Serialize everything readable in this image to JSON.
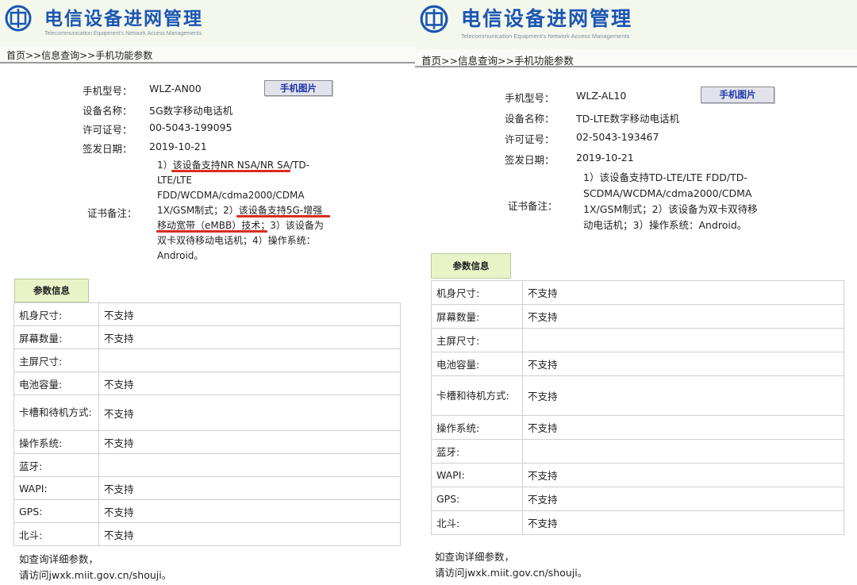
{
  "banner": {
    "title": "电信设备进网管理",
    "subtitle": "Telecommunication Equipment's Network Access Managements"
  },
  "breadcrumb": "首页>>信息查询>>手机功能参数",
  "labels": {
    "model": "手机型号：",
    "device_name": "设备名称：",
    "license": "许可证号：",
    "issue_date": "签发日期：",
    "remarks": "证书备注：",
    "photo_button": "手机图片",
    "params_header": "参数信息"
  },
  "left": {
    "model": "WLZ-AN00",
    "device_name": "5G数字移动电话机",
    "license": "00-5043-199095",
    "issue_date": "2019-10-21",
    "remarks_lines": [
      "1）该设备支持NR NSA/NR SA/TD-",
      "LTE/LTE",
      "FDD/WCDMA/cdma2000/CDMA",
      "1X/GSM制式；2）该设备支持5G-增强",
      "移动宽带（eMBB）技术；3）该设备为",
      "双卡双待移动电话机；4）操作系统：",
      "Android。"
    ],
    "params": [
      {
        "label": "机身尺寸:",
        "value": "不支持"
      },
      {
        "label": "屏幕数量:",
        "value": "不支持"
      },
      {
        "label": "主屏尺寸:",
        "value": ""
      },
      {
        "label": "电池容量:",
        "value": "不支持"
      },
      {
        "label": "卡槽和待机方式:",
        "value": "不支持"
      },
      {
        "label": "操作系统:",
        "value": "不支持"
      },
      {
        "label": "蓝牙:",
        "value": ""
      },
      {
        "label": "WAPI:",
        "value": "不支持"
      },
      {
        "label": "GPS:",
        "value": "不支持"
      },
      {
        "label": "北斗:",
        "value": "不支持"
      }
    ]
  },
  "right": {
    "model": "WLZ-AL10",
    "device_name": "TD-LTE数字移动电话机",
    "license": "02-5043-193467",
    "issue_date": "2019-10-21",
    "remarks_lines": [
      "1）该设备支持TD-LTE/LTE FDD/TD-",
      "SCDMA/WCDMA/cdma2000/CDMA",
      "1X/GSM制式；2）该设备为双卡双待移",
      "动电话机；3）操作系统：Android。"
    ],
    "params": [
      {
        "label": "机身尺寸:",
        "value": "不支持"
      },
      {
        "label": "屏幕数量:",
        "value": "不支持"
      },
      {
        "label": "主屏尺寸:",
        "value": ""
      },
      {
        "label": "电池容量:",
        "value": "不支持"
      },
      {
        "label": "卡槽和待机方式:",
        "value": "不支持"
      },
      {
        "label": "操作系统:",
        "value": "不支持"
      },
      {
        "label": "蓝牙:",
        "value": ""
      },
      {
        "label": "WAPI:",
        "value": "不支持"
      },
      {
        "label": "GPS:",
        "value": "不支持"
      },
      {
        "label": "北斗:",
        "value": "不支持"
      }
    ]
  },
  "footer": {
    "line1": "如查询详细参数，",
    "line2": "请访问jwxk.miit.gov.cn/shouji。"
  },
  "colors": {
    "title_blue": "#1b56b3",
    "button_text": "#1f35a8",
    "header_green": "#e9f3c8",
    "underline_red": "#d62d20"
  }
}
